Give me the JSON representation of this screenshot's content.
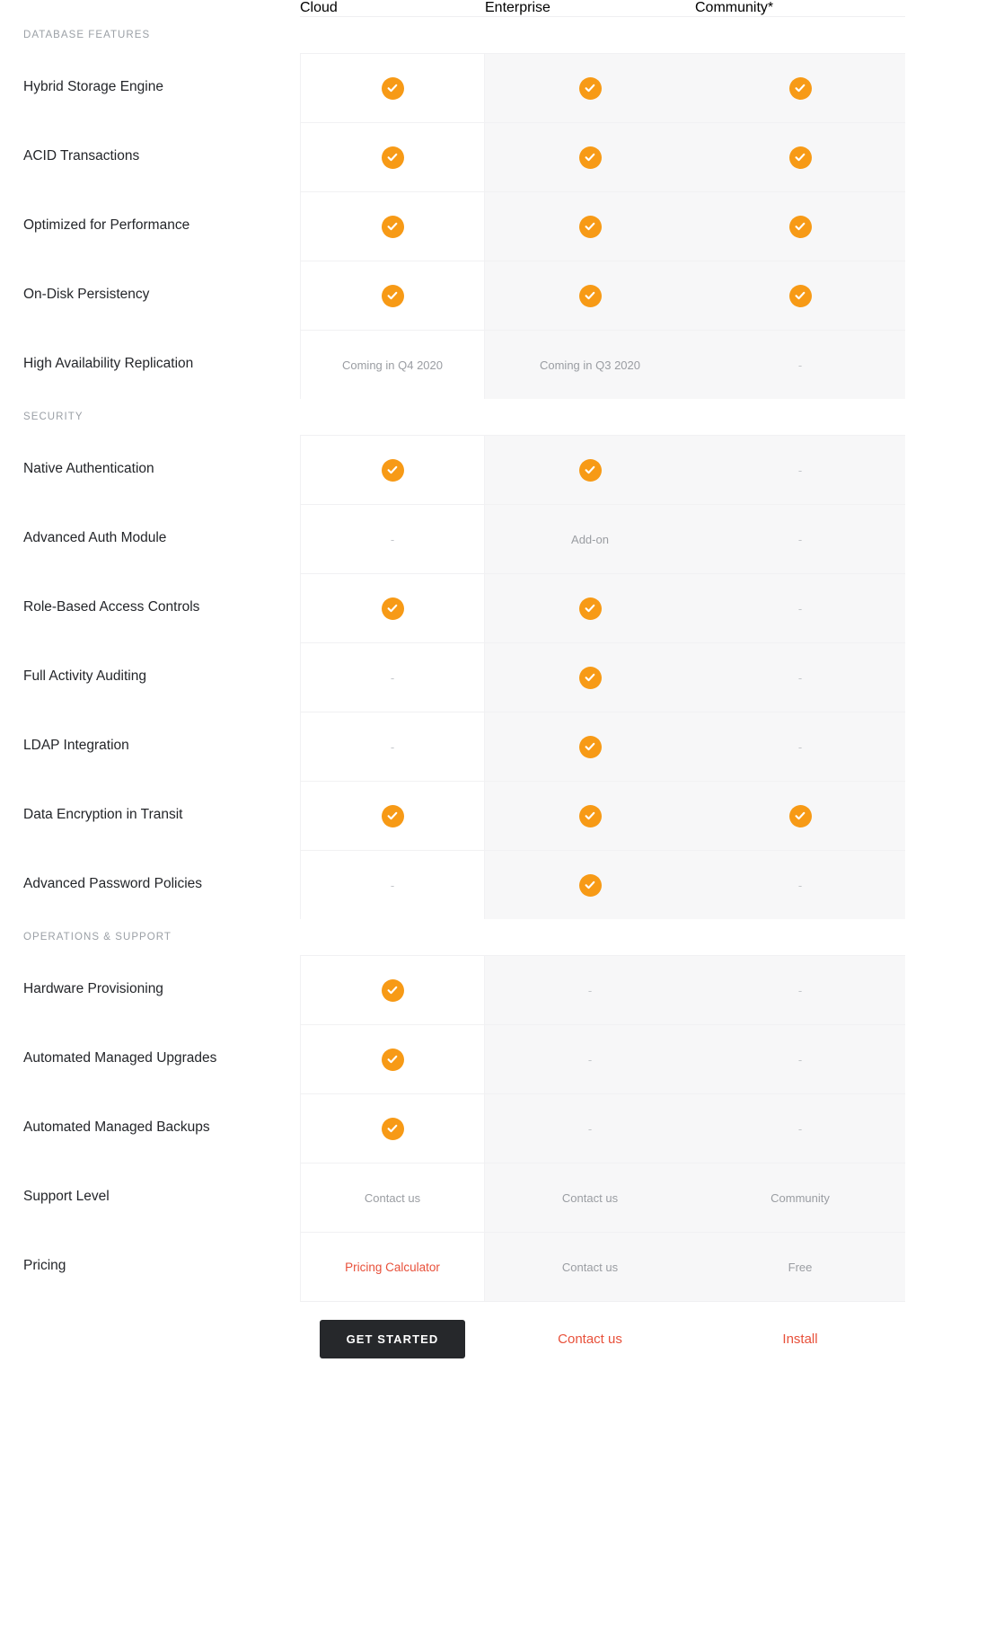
{
  "table": {
    "row_header_column_label": "",
    "columns": [
      {
        "id": "cloud",
        "label": "Cloud",
        "highlighted": true
      },
      {
        "id": "enterprise",
        "label": "Enterprise",
        "highlighted": false
      },
      {
        "id": "community",
        "label": "Community*",
        "highlighted": false
      }
    ],
    "sections": [
      {
        "id": "database-features",
        "title": "DATABASE FEATURES",
        "rows": [
          {
            "feature": "Hybrid Storage Engine",
            "cloud": "check",
            "enterprise": "check",
            "community": "check"
          },
          {
            "feature": "ACID Transactions",
            "cloud": "check",
            "enterprise": "check",
            "community": "check"
          },
          {
            "feature": "Optimized for Performance",
            "cloud": "check",
            "enterprise": "check",
            "community": "check"
          },
          {
            "feature": "On-Disk Persistency",
            "cloud": "check",
            "enterprise": "check",
            "community": "check"
          },
          {
            "feature": "High Availability Replication",
            "cloud": "Coming in Q4 2020",
            "enterprise": "Coming in Q3 2020",
            "community": "-"
          }
        ]
      },
      {
        "id": "security",
        "title": "SECURITY",
        "rows": [
          {
            "feature": "Native Authentication",
            "cloud": "check",
            "enterprise": "check",
            "community": "-"
          },
          {
            "feature": "Advanced Auth Module",
            "cloud": "-",
            "enterprise": "Add-on",
            "community": "-"
          },
          {
            "feature": "Role-Based Access Controls",
            "cloud": "check",
            "enterprise": "check",
            "community": "-"
          },
          {
            "feature": "Full Activity Auditing",
            "cloud": "-",
            "enterprise": "check",
            "community": "-"
          },
          {
            "feature": "LDAP Integration",
            "cloud": "-",
            "enterprise": "check",
            "community": "-"
          },
          {
            "feature": "Data Encryption in Transit",
            "cloud": "check",
            "enterprise": "check",
            "community": "check"
          },
          {
            "feature": "Advanced Password Policies",
            "cloud": "-",
            "enterprise": "check",
            "community": "-"
          }
        ]
      },
      {
        "id": "operations-support",
        "title": "OPERATIONS & SUPPORT",
        "rows": [
          {
            "feature": "Hardware Provisioning",
            "cloud": "check",
            "enterprise": "-",
            "community": "-"
          },
          {
            "feature": "Automated Managed Upgrades",
            "cloud": "check",
            "enterprise": "-",
            "community": "-"
          },
          {
            "feature": "Automated Managed Backups",
            "cloud": "check",
            "enterprise": "-",
            "community": "-"
          },
          {
            "feature": "Support Level",
            "cloud": "Contact us",
            "enterprise": "Contact us",
            "community": "Community"
          },
          {
            "feature": "Pricing",
            "cloud": "Pricing Calculator",
            "cloud_accent": true,
            "enterprise": "Contact us",
            "community": "Free"
          }
        ]
      }
    ],
    "cta": {
      "cloud": {
        "label": "GET STARTED",
        "style": "button-dark"
      },
      "enterprise": {
        "label": "Contact us",
        "style": "link-accent"
      },
      "community": {
        "label": "Install",
        "style": "link-accent"
      }
    }
  },
  "icons": {
    "check": "check-circle-icon",
    "empty": "-"
  },
  "colors": {
    "check_badge": "#f79a16",
    "accent_link": "#e8503a",
    "cta_button_bg": "#26282b",
    "column_shade": "#f7f7f8",
    "muted_text": "#9a9da2",
    "section_label": "#9ba0a6"
  }
}
